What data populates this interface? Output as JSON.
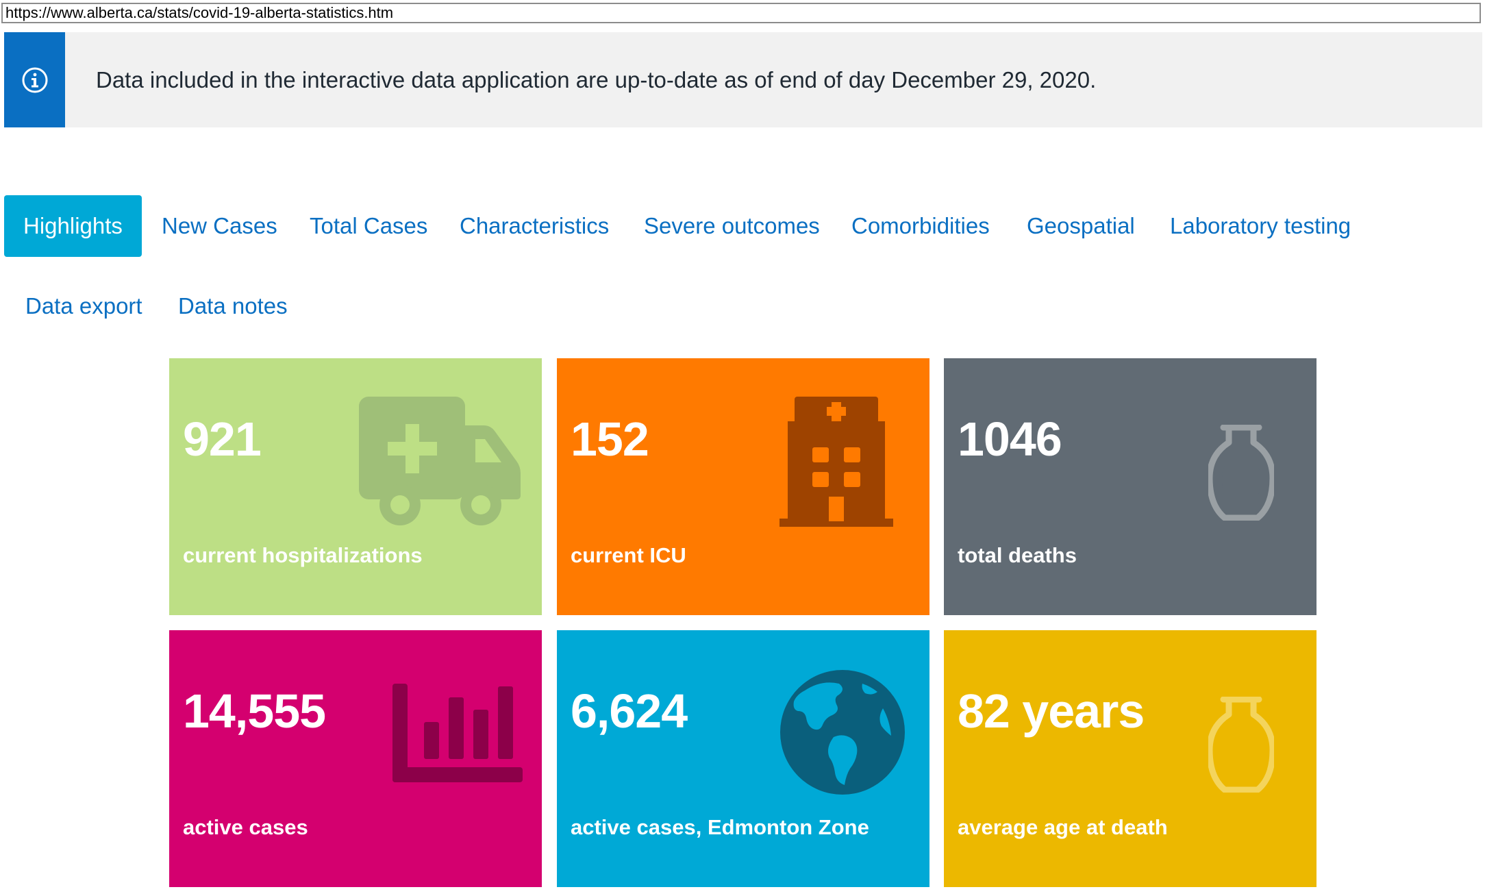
{
  "browser": {
    "url": "https://www.alberta.ca/stats/covid-19-alberta-statistics.htm"
  },
  "notice": {
    "icon": "info-icon",
    "text": "Data included in the interactive data application are up-to-date as of end of day December 29, 2020."
  },
  "tabs": [
    {
      "label": "Highlights",
      "active": true
    },
    {
      "label": "New Cases"
    },
    {
      "label": "Total Cases"
    },
    {
      "label": "Characteristics"
    },
    {
      "label": "Severe outcomes"
    },
    {
      "label": "Comorbidities"
    },
    {
      "label": "Geospatial"
    },
    {
      "label": "Laboratory testing"
    },
    {
      "label": "Data export"
    },
    {
      "label": "Data notes"
    }
  ],
  "tiles": [
    {
      "value": "921",
      "label": "current hospitalizations",
      "icon": "ambulance-icon",
      "color": "#bddf85"
    },
    {
      "value": "152",
      "label": "current ICU",
      "icon": "hospital-icon",
      "color": "#ff7a00"
    },
    {
      "value": "1046",
      "label": "total deaths",
      "icon": "urn-icon",
      "color": "#616b74"
    },
    {
      "value": "14,555",
      "label": "active cases",
      "icon": "bar-chart-icon",
      "color": "#d4006f"
    },
    {
      "value": "6,624",
      "label": "active cases, Edmonton Zone",
      "icon": "globe-icon",
      "color": "#00a9d6"
    },
    {
      "value": "82 years",
      "label": "average age at death",
      "icon": "urn-icon",
      "color": "#ecb800"
    }
  ]
}
